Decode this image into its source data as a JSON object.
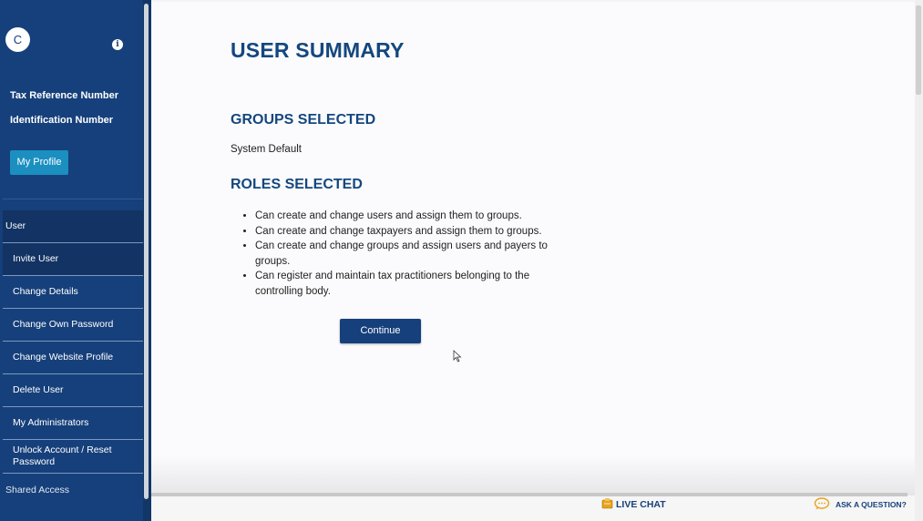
{
  "sidebar": {
    "avatar_initial": "C",
    "tax_reference_label": "Tax Reference Number",
    "identification_label": "Identification Number",
    "profile_button": "My Profile",
    "section_label": "User",
    "items": [
      {
        "label": "Invite User"
      },
      {
        "label": "Change Details"
      },
      {
        "label": "Change Own Password"
      },
      {
        "label": "Change Website Profile"
      },
      {
        "label": "Delete User"
      },
      {
        "label": "My Administrators"
      },
      {
        "label": "Unlock Account / Reset Password"
      }
    ],
    "shared_access_label": "Shared Access",
    "icons": {
      "info": "info-icon"
    }
  },
  "main": {
    "title": "USER SUMMARY",
    "groups_heading": "GROUPS SELECTED",
    "groups_value": "System Default",
    "roles_heading": "ROLES SELECTED",
    "roles": [
      "Can create and change users and assign them to groups.",
      "Can create and change taxpayers and assign them to groups.",
      "Can create and change groups and assign users and payers to groups.",
      "Can register and maintain tax practitioners belonging to the controlling body."
    ],
    "continue_label": "Continue"
  },
  "footer": {
    "live_chat": "LIVE CHAT",
    "ask_question": "ASK A QUESTION?"
  },
  "colors": {
    "brand": "#16407b",
    "heading": "#14477e",
    "profile_button": "#1a8fc0"
  }
}
